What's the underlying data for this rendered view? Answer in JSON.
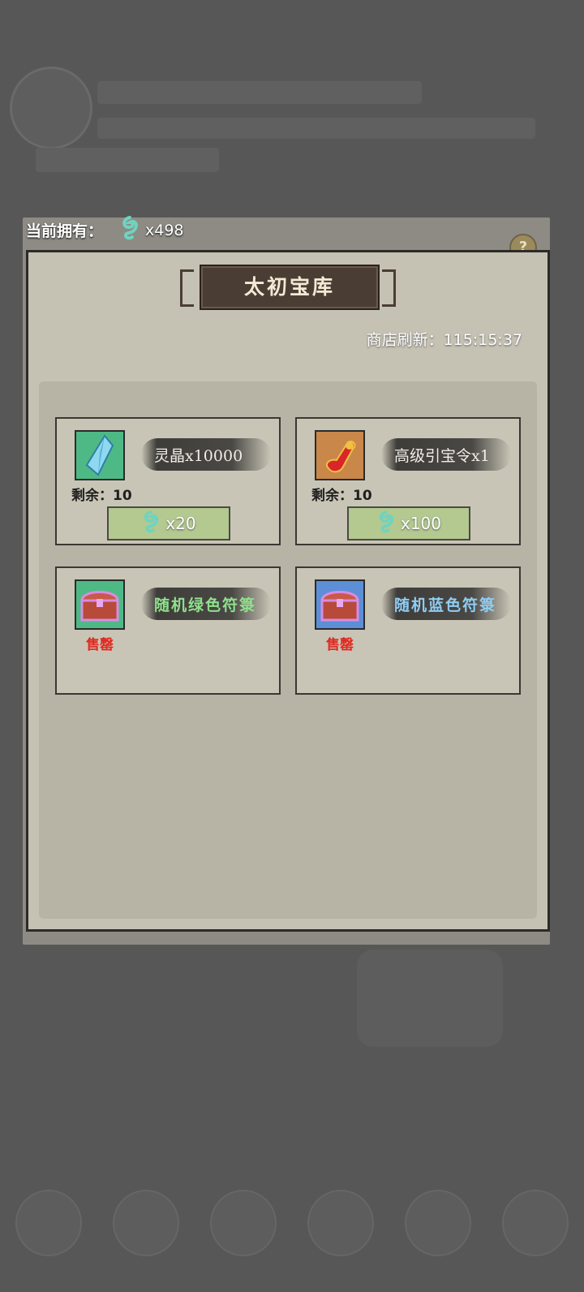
{
  "header": {
    "owned_label": "当前拥有：",
    "owned_amount": "x498",
    "currency_icon": "spirit-jade-icon"
  },
  "shop": {
    "title": "太初宝库",
    "refresh_label": "商店刷新：",
    "refresh_time": "115:15:37"
  },
  "items": [
    {
      "name": "灵晶x10000",
      "stock_label": "剩余：",
      "stock": "10",
      "price": "x20",
      "icon": "crystal-icon",
      "icon_bg": "#4fb986"
    },
    {
      "name": "高级引宝令x1",
      "stock_label": "剩余：",
      "stock": "10",
      "price": "x100",
      "icon": "treasure-token-icon",
      "icon_bg": "#c9874a"
    },
    {
      "name": "随机绿色符箓",
      "status": "售罄",
      "icon": "treasure-chest-icon",
      "icon_bg": "#4fb986",
      "name_color": "green"
    },
    {
      "name": "随机蓝色符箓",
      "status": "售罄",
      "icon": "treasure-chest-icon",
      "icon_bg": "#5c8fd6",
      "name_color": "blue"
    }
  ]
}
